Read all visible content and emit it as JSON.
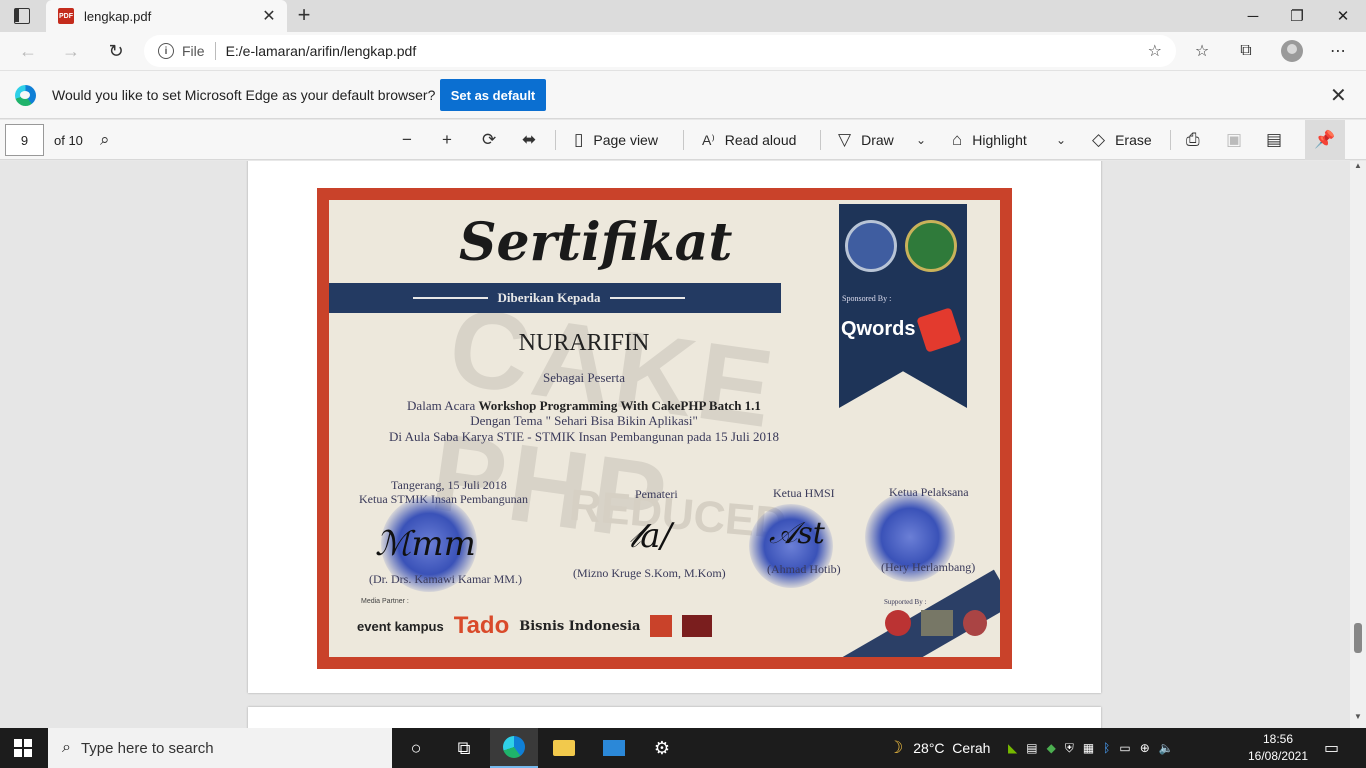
{
  "browser": {
    "tab_title": "lengkap.pdf",
    "address_scheme_label": "File",
    "address_url": "E:/e-lamaran/arifin/lengkap.pdf"
  },
  "infobar": {
    "message": "Would you like to set Microsoft Edge as your default browser?",
    "button_label": "Set as default"
  },
  "pdf_toolbar": {
    "page_number": "9",
    "page_count": "of 10",
    "page_view_label": "Page view",
    "read_aloud_label": "Read aloud",
    "draw_label": "Draw",
    "highlight_label": "Highlight",
    "erase_label": "Erase"
  },
  "certificate": {
    "title": "Sertifikat",
    "band_text": "Diberikan Kepada",
    "sponsored_by": "Sponsored By :",
    "sponsor_name": "Qwords",
    "recipient": "NURARIFIN",
    "role": "Sebagai Peserta",
    "event_prefix": "Dalam Acara ",
    "event_name": "Workshop Programming With CakePHP Batch 1.1",
    "theme": "Dengan Tema \" Sehari Bisa Bikin Aplikasi\"",
    "venue": "Di Aula Saba Karya STIE - STMIK Insan Pembangunan pada 15 Juli 2018",
    "place_date": "Tangerang, 15 Juli 2018",
    "signer1_title": "Ketua STMIK Insan Pembangunan",
    "signer1_name": "(Dr. Drs. Kamawi Kamar MM.)",
    "signer2_title": "Pemateri",
    "signer2_name": "(Mizno Kruge S.Kom, M.Kom)",
    "signer3_title": "Ketua HMSI",
    "signer3_name": "(Ahmad Hotib)",
    "signer4_title": "Ketua Pelaksana",
    "signer4_name": "(Hery Herlambang)",
    "media_partner_label": "Media Partner :",
    "partner1": "event kampus",
    "partner2": "Tado",
    "partner3": "Bisnis Indonesia",
    "supported_by": "Supported By :"
  },
  "taskbar": {
    "search_placeholder": "Type here to search",
    "weather": "28°C  Cerah",
    "time": "18:56",
    "date": "16/08/2021"
  }
}
